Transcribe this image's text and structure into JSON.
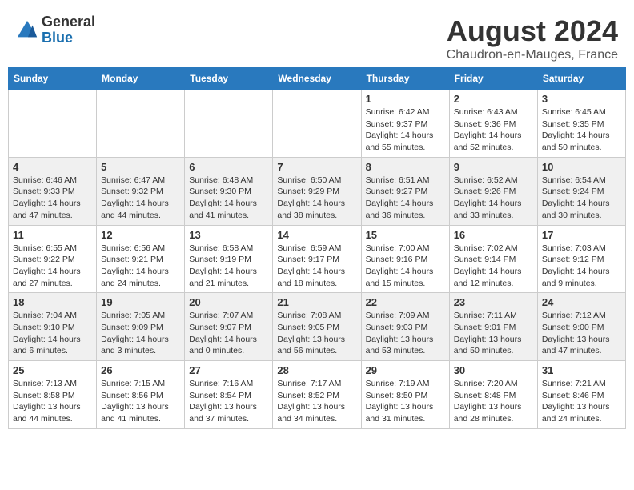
{
  "header": {
    "logo_general": "General",
    "logo_blue": "Blue",
    "month_year": "August 2024",
    "location": "Chaudron-en-Mauges, France"
  },
  "weekdays": [
    "Sunday",
    "Monday",
    "Tuesday",
    "Wednesday",
    "Thursday",
    "Friday",
    "Saturday"
  ],
  "weeks": [
    [
      {
        "day": "",
        "sunrise": "",
        "sunset": "",
        "daylight": ""
      },
      {
        "day": "",
        "sunrise": "",
        "sunset": "",
        "daylight": ""
      },
      {
        "day": "",
        "sunrise": "",
        "sunset": "",
        "daylight": ""
      },
      {
        "day": "",
        "sunrise": "",
        "sunset": "",
        "daylight": ""
      },
      {
        "day": "1",
        "sunrise": "Sunrise: 6:42 AM",
        "sunset": "Sunset: 9:37 PM",
        "daylight": "Daylight: 14 hours and 55 minutes."
      },
      {
        "day": "2",
        "sunrise": "Sunrise: 6:43 AM",
        "sunset": "Sunset: 9:36 PM",
        "daylight": "Daylight: 14 hours and 52 minutes."
      },
      {
        "day": "3",
        "sunrise": "Sunrise: 6:45 AM",
        "sunset": "Sunset: 9:35 PM",
        "daylight": "Daylight: 14 hours and 50 minutes."
      }
    ],
    [
      {
        "day": "4",
        "sunrise": "Sunrise: 6:46 AM",
        "sunset": "Sunset: 9:33 PM",
        "daylight": "Daylight: 14 hours and 47 minutes."
      },
      {
        "day": "5",
        "sunrise": "Sunrise: 6:47 AM",
        "sunset": "Sunset: 9:32 PM",
        "daylight": "Daylight: 14 hours and 44 minutes."
      },
      {
        "day": "6",
        "sunrise": "Sunrise: 6:48 AM",
        "sunset": "Sunset: 9:30 PM",
        "daylight": "Daylight: 14 hours and 41 minutes."
      },
      {
        "day": "7",
        "sunrise": "Sunrise: 6:50 AM",
        "sunset": "Sunset: 9:29 PM",
        "daylight": "Daylight: 14 hours and 38 minutes."
      },
      {
        "day": "8",
        "sunrise": "Sunrise: 6:51 AM",
        "sunset": "Sunset: 9:27 PM",
        "daylight": "Daylight: 14 hours and 36 minutes."
      },
      {
        "day": "9",
        "sunrise": "Sunrise: 6:52 AM",
        "sunset": "Sunset: 9:26 PM",
        "daylight": "Daylight: 14 hours and 33 minutes."
      },
      {
        "day": "10",
        "sunrise": "Sunrise: 6:54 AM",
        "sunset": "Sunset: 9:24 PM",
        "daylight": "Daylight: 14 hours and 30 minutes."
      }
    ],
    [
      {
        "day": "11",
        "sunrise": "Sunrise: 6:55 AM",
        "sunset": "Sunset: 9:22 PM",
        "daylight": "Daylight: 14 hours and 27 minutes."
      },
      {
        "day": "12",
        "sunrise": "Sunrise: 6:56 AM",
        "sunset": "Sunset: 9:21 PM",
        "daylight": "Daylight: 14 hours and 24 minutes."
      },
      {
        "day": "13",
        "sunrise": "Sunrise: 6:58 AM",
        "sunset": "Sunset: 9:19 PM",
        "daylight": "Daylight: 14 hours and 21 minutes."
      },
      {
        "day": "14",
        "sunrise": "Sunrise: 6:59 AM",
        "sunset": "Sunset: 9:17 PM",
        "daylight": "Daylight: 14 hours and 18 minutes."
      },
      {
        "day": "15",
        "sunrise": "Sunrise: 7:00 AM",
        "sunset": "Sunset: 9:16 PM",
        "daylight": "Daylight: 14 hours and 15 minutes."
      },
      {
        "day": "16",
        "sunrise": "Sunrise: 7:02 AM",
        "sunset": "Sunset: 9:14 PM",
        "daylight": "Daylight: 14 hours and 12 minutes."
      },
      {
        "day": "17",
        "sunrise": "Sunrise: 7:03 AM",
        "sunset": "Sunset: 9:12 PM",
        "daylight": "Daylight: 14 hours and 9 minutes."
      }
    ],
    [
      {
        "day": "18",
        "sunrise": "Sunrise: 7:04 AM",
        "sunset": "Sunset: 9:10 PM",
        "daylight": "Daylight: 14 hours and 6 minutes."
      },
      {
        "day": "19",
        "sunrise": "Sunrise: 7:05 AM",
        "sunset": "Sunset: 9:09 PM",
        "daylight": "Daylight: 14 hours and 3 minutes."
      },
      {
        "day": "20",
        "sunrise": "Sunrise: 7:07 AM",
        "sunset": "Sunset: 9:07 PM",
        "daylight": "Daylight: 14 hours and 0 minutes."
      },
      {
        "day": "21",
        "sunrise": "Sunrise: 7:08 AM",
        "sunset": "Sunset: 9:05 PM",
        "daylight": "Daylight: 13 hours and 56 minutes."
      },
      {
        "day": "22",
        "sunrise": "Sunrise: 7:09 AM",
        "sunset": "Sunset: 9:03 PM",
        "daylight": "Daylight: 13 hours and 53 minutes."
      },
      {
        "day": "23",
        "sunrise": "Sunrise: 7:11 AM",
        "sunset": "Sunset: 9:01 PM",
        "daylight": "Daylight: 13 hours and 50 minutes."
      },
      {
        "day": "24",
        "sunrise": "Sunrise: 7:12 AM",
        "sunset": "Sunset: 9:00 PM",
        "daylight": "Daylight: 13 hours and 47 minutes."
      }
    ],
    [
      {
        "day": "25",
        "sunrise": "Sunrise: 7:13 AM",
        "sunset": "Sunset: 8:58 PM",
        "daylight": "Daylight: 13 hours and 44 minutes."
      },
      {
        "day": "26",
        "sunrise": "Sunrise: 7:15 AM",
        "sunset": "Sunset: 8:56 PM",
        "daylight": "Daylight: 13 hours and 41 minutes."
      },
      {
        "day": "27",
        "sunrise": "Sunrise: 7:16 AM",
        "sunset": "Sunset: 8:54 PM",
        "daylight": "Daylight: 13 hours and 37 minutes."
      },
      {
        "day": "28",
        "sunrise": "Sunrise: 7:17 AM",
        "sunset": "Sunset: 8:52 PM",
        "daylight": "Daylight: 13 hours and 34 minutes."
      },
      {
        "day": "29",
        "sunrise": "Sunrise: 7:19 AM",
        "sunset": "Sunset: 8:50 PM",
        "daylight": "Daylight: 13 hours and 31 minutes."
      },
      {
        "day": "30",
        "sunrise": "Sunrise: 7:20 AM",
        "sunset": "Sunset: 8:48 PM",
        "daylight": "Daylight: 13 hours and 28 minutes."
      },
      {
        "day": "31",
        "sunrise": "Sunrise: 7:21 AM",
        "sunset": "Sunset: 8:46 PM",
        "daylight": "Daylight: 13 hours and 24 minutes."
      }
    ]
  ]
}
